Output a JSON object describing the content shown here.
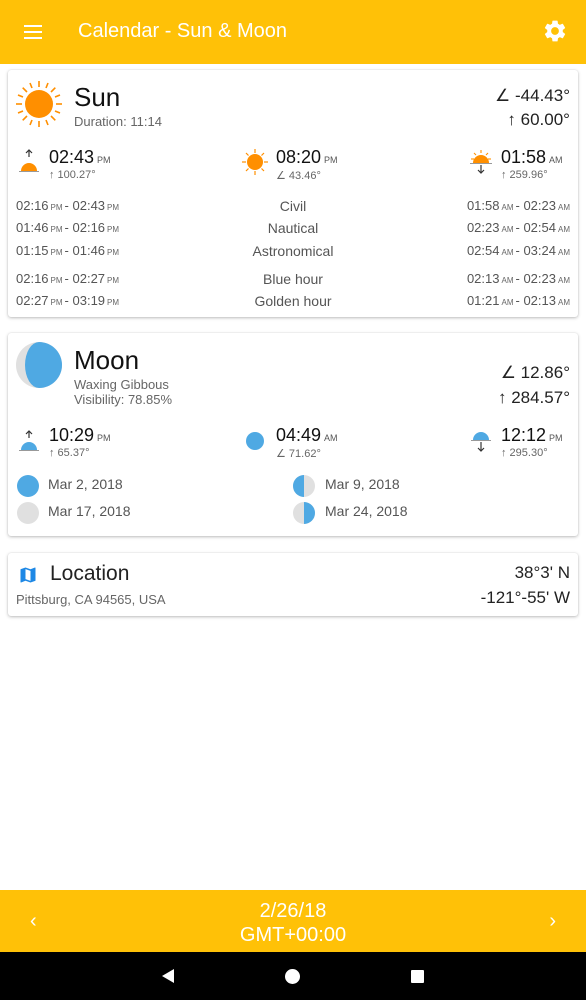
{
  "appbar": {
    "title": "Calendar - Sun & Moon",
    "menu_icon": "hamburger-menu-icon",
    "settings_icon": "gear-icon",
    "color": "#FFC107"
  },
  "sun": {
    "title": "Sun",
    "duration": "Duration: 11:14",
    "elevation": "∠ -44.43°",
    "azimuth": "↑ 60.00°",
    "rise": {
      "time": "02:43",
      "ampm": "PM",
      "deg": "↑ 100.27°"
    },
    "noon": {
      "time": "08:20",
      "ampm": "PM",
      "deg": "∠ 43.46°"
    },
    "set": {
      "time": "01:58",
      "ampm": "AM",
      "deg": "↑ 259.96°"
    },
    "twilight": [
      {
        "left_a": "02:16",
        "left_a_ap": "PM",
        "left_b": "02:43",
        "left_b_ap": "PM",
        "label": "Civil",
        "right_a": "01:58",
        "right_a_ap": "AM",
        "right_b": "02:23",
        "right_b_ap": "AM"
      },
      {
        "left_a": "01:46",
        "left_a_ap": "PM",
        "left_b": "02:16",
        "left_b_ap": "PM",
        "label": "Nautical",
        "right_a": "02:23",
        "right_a_ap": "AM",
        "right_b": "02:54",
        "right_b_ap": "AM"
      },
      {
        "left_a": "01:15",
        "left_a_ap": "PM",
        "left_b": "01:46",
        "left_b_ap": "PM",
        "label": "Astronomical",
        "right_a": "02:54",
        "right_a_ap": "AM",
        "right_b": "03:24",
        "right_b_ap": "AM"
      },
      {
        "left_a": "02:16",
        "left_a_ap": "PM",
        "left_b": "02:27",
        "left_b_ap": "PM",
        "label": "Blue hour",
        "right_a": "02:13",
        "right_a_ap": "AM",
        "right_b": "02:23",
        "right_b_ap": "AM"
      },
      {
        "left_a": "02:27",
        "left_a_ap": "PM",
        "left_b": "03:19",
        "left_b_ap": "PM",
        "label": "Golden hour",
        "right_a": "01:21",
        "right_a_ap": "AM",
        "right_b": "02:13",
        "right_b_ap": "AM"
      }
    ]
  },
  "moon": {
    "title": "Moon",
    "phase": "Waxing Gibbous",
    "visibility": "Visibility: 78.85%",
    "elevation": "∠ 12.86°",
    "azimuth": "↑ 284.57°",
    "rise": {
      "time": "10:29",
      "ampm": "PM",
      "deg": "↑ 65.37°"
    },
    "transit": {
      "time": "04:49",
      "ampm": "AM",
      "deg": "∠ 71.62°"
    },
    "set": {
      "time": "12:12",
      "ampm": "PM",
      "deg": "↑ 295.30°"
    },
    "phases": [
      {
        "date": "Mar 2, 2018",
        "icon": "full-moon-icon"
      },
      {
        "date": "Mar 9, 2018",
        "icon": "last-quarter-moon-icon"
      },
      {
        "date": "Mar 17, 2018",
        "icon": "new-moon-icon"
      },
      {
        "date": "Mar 24, 2018",
        "icon": "first-quarter-moon-icon"
      }
    ]
  },
  "location": {
    "title": "Location",
    "address": "Pittsburg, CA 94565, USA",
    "lat": "38°3' N",
    "lon": "-121°-55' W"
  },
  "bottom": {
    "date": "2/26/18",
    "tz": "GMT+00:00",
    "prev": "‹",
    "next": "›"
  },
  "colors": {
    "accent": "#FFC107",
    "sun": "#FF8F00",
    "moon": "#4FA9E3",
    "moon_dark": "#E0E0E0"
  }
}
